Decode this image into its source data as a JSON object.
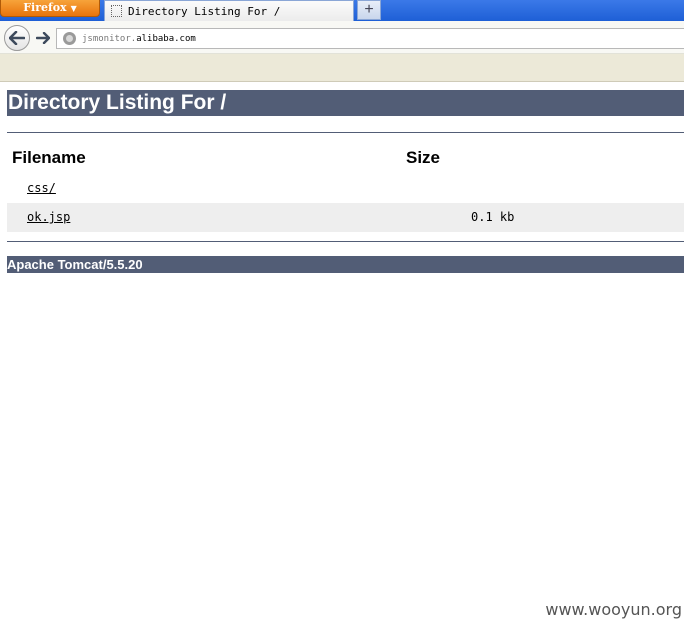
{
  "browser": {
    "menu_button_label": "Firefox",
    "tab": {
      "title": "Directory Listing For /"
    },
    "new_tab_label": "+",
    "url": {
      "prefix": "jsmonitor.",
      "host": "alibaba.com"
    }
  },
  "page": {
    "title": "Directory Listing For /",
    "columns": {
      "filename": "Filename",
      "size": "Size"
    },
    "files": [
      {
        "name": "css/",
        "size": ""
      },
      {
        "name": "ok.jsp",
        "size": "0.1 kb"
      }
    ],
    "footer": "Apache Tomcat/5.5.20"
  },
  "watermark": "www.wooyun.org",
  "colors": {
    "heading_bar": "#525d76",
    "row_alt": "#eeeeee",
    "firefox_button": "#e8740c",
    "tabstrip": "#1e5fd6"
  }
}
